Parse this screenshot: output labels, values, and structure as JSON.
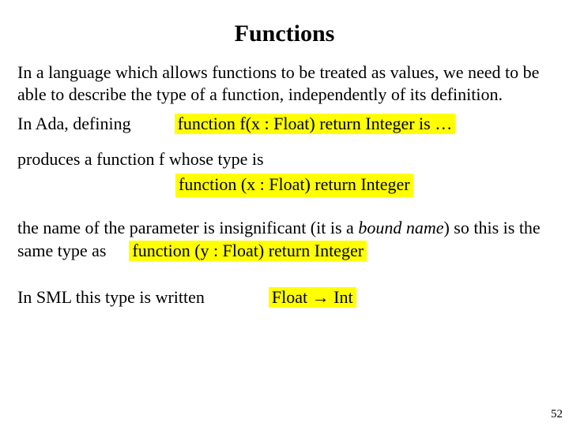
{
  "title": "Functions",
  "para1": "In a language which allows functions to be treated as values, we need to be able to describe the type of a function, independently of its definition.",
  "ada_label": "In Ada, defining",
  "ada_code": "function f(x : Float) return Integer is …",
  "produces": "produces a function f whose type is",
  "type1_code": "function (x : Float) return Integer",
  "bound_pre": "the name of the parameter is insignificant (it is a ",
  "bound_italic": "bound name",
  "bound_post": ") so this is the same type as",
  "type2_code": "function (y : Float) return Integer",
  "sml_label": "In SML this type is written",
  "sml_code": "Float → Int",
  "pagenum": "52"
}
